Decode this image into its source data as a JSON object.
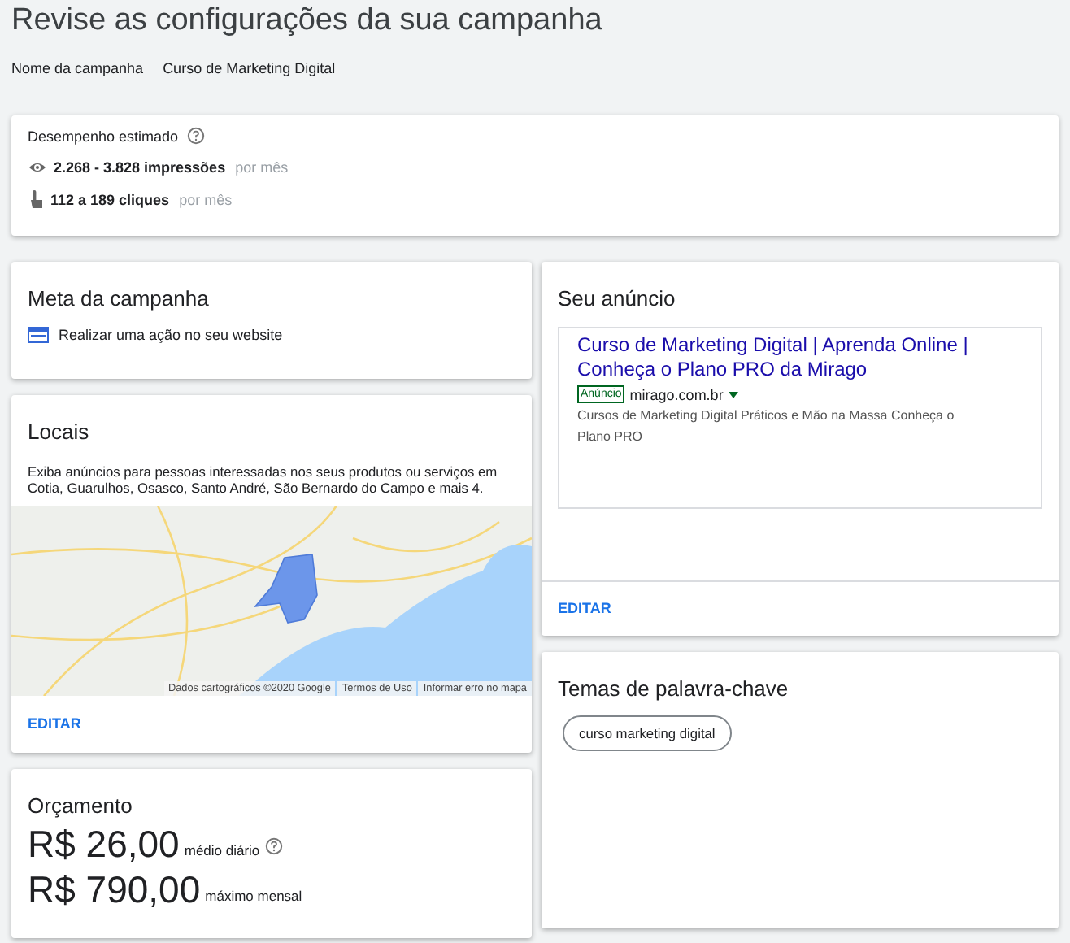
{
  "page_title": "Revise as configurações da sua campanha",
  "campaign_name": {
    "label": "Nome da campanha",
    "value": "Curso de Marketing Digital"
  },
  "performance": {
    "title": "Desempenho estimado",
    "help_icon": true,
    "metrics": [
      {
        "kind": "impressions",
        "value": "2.268 - 3.828 impressões",
        "unit": "por mês"
      },
      {
        "kind": "clicks",
        "value": "112 a 189 cliques",
        "unit": "por mês"
      }
    ]
  },
  "goal": {
    "title": "Meta da campanha",
    "item": "Realizar uma ação no seu website"
  },
  "locations": {
    "title": "Locais",
    "description": "Exiba anúncios para pessoas interessadas nos seus produtos ou serviços em Cotia, Guarulhos, Osasco, Santo André, São Bernardo do Campo e mais 4.",
    "map_links": [
      "Dados cartográficos ©2020 Google",
      "Termos de Uso",
      "Informar erro no mapa"
    ],
    "edit": "EDITAR"
  },
  "budget": {
    "title": "Orçamento",
    "amounts": [
      {
        "value": "R$ 26,00",
        "unit": "médio diário",
        "help_icon": true
      },
      {
        "value": "R$ 790,00",
        "unit": "máximo mensal",
        "help_icon": false
      }
    ]
  },
  "ad": {
    "title": "Seu anúncio",
    "headline": "Curso de Marketing Digital | Aprenda Online | Conheça o Plano PRO da Mirago",
    "badge": "Anúncio",
    "url": "mirago.com.br",
    "description": "Cursos de Marketing Digital Práticos e Mão na Massa Conheça o Plano PRO",
    "edit": "EDITAR"
  },
  "keywords": {
    "title": "Temas de palavra-chave",
    "chips": [
      "curso marketing digital"
    ]
  }
}
